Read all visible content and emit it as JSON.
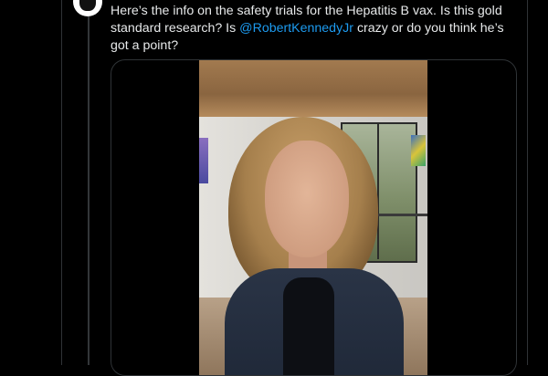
{
  "tweet": {
    "text_before_mention": "Here’s the info on the safety trials for the Hepatitis B vax.  Is this gold standard research? Is ",
    "mention": "@RobertKennedyJr",
    "text_after_mention": " crazy or do you think he’s got a point?"
  },
  "colors": {
    "background": "#000000",
    "text": "#e7e9ea",
    "mention": "#1d9bf0",
    "border": "#2f3336"
  },
  "icons": {
    "avatar": "user-avatar-icon"
  }
}
